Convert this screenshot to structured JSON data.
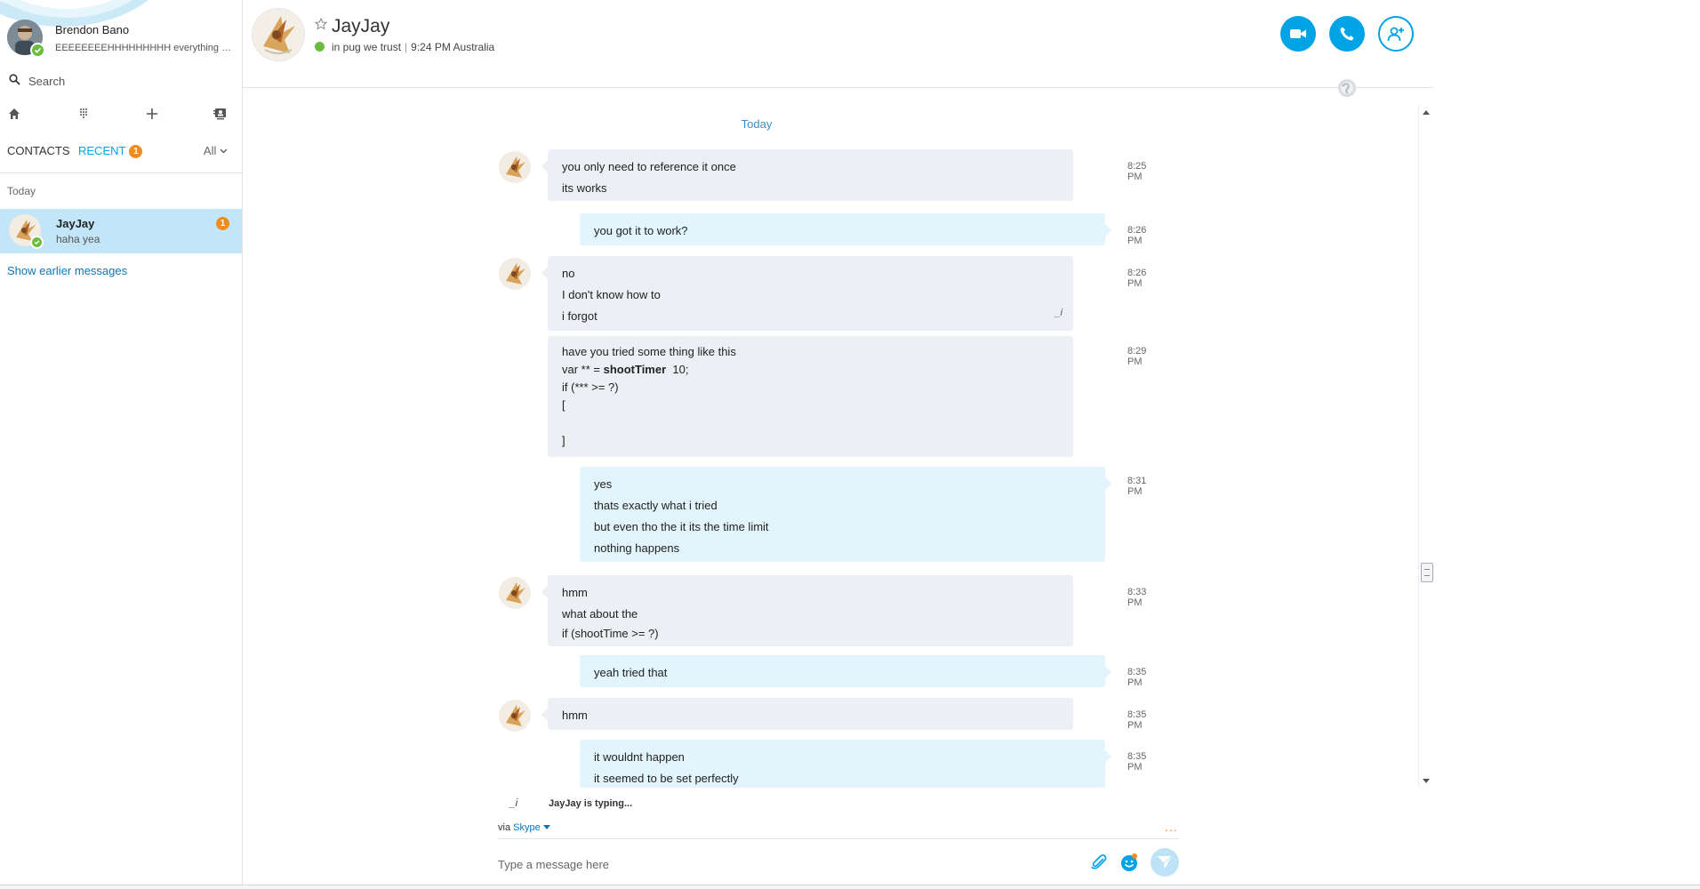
{
  "colors": {
    "accent": "#00a3e6",
    "link": "#0a77b8",
    "badge": "#f08b1d",
    "presence_online": "#6cbc3f",
    "incoming_bubble": "#eceff3",
    "outgoing_bubble": "#e2f4fc",
    "selected_row": "#c2e6f7"
  },
  "profile": {
    "name": "Brendon Bano",
    "mood": "EEEEEEEEHHHHHHHHH everything s...",
    "status": "online"
  },
  "search": {
    "placeholder": "Search"
  },
  "nav_icons": [
    "home-icon",
    "dialpad-icon",
    "plus-icon",
    "contacts-book-icon"
  ],
  "tabs": {
    "contacts": "CONTACTS",
    "recent": "RECENT",
    "recent_badge": "1",
    "filter": "All"
  },
  "recent_list": {
    "section_label": "Today",
    "items": [
      {
        "name": "JayJay",
        "preview": "haha yea",
        "badge": "1",
        "status": "online"
      }
    ],
    "show_earlier": "Show earlier messages"
  },
  "header": {
    "contact_name": "JayJay",
    "mood": "in pug we trust",
    "local_time": "9:24 PM Australia",
    "buttons": [
      "video-call",
      "audio-call",
      "add-people"
    ]
  },
  "conversation": {
    "date_divider": "Today",
    "messages": [
      {
        "dir": "in",
        "time": "8:25 PM",
        "lines": [
          "you only need to reference it once",
          "its works"
        ]
      },
      {
        "dir": "out",
        "time": "8:26 PM",
        "lines": [
          "you got it to work?"
        ]
      },
      {
        "dir": "in",
        "time": "8:26 PM",
        "lines": [
          "no",
          "I don't know how to",
          "i forgot"
        ],
        "edited_icon": "_i"
      },
      {
        "dir": "in",
        "time": "8:29 PM",
        "continued": true,
        "code": true,
        "lines": [
          "have you tried some thing like this",
          "var ** = ",
          "if (*** >= ?)",
          "[",
          "",
          "]"
        ],
        "bold_fragment": "shootTimer",
        "after_bold": "  10;"
      },
      {
        "dir": "out",
        "time": "8:31 PM",
        "lines": [
          "yes",
          "thats exactly what i tried",
          "but even tho the it its the time limit",
          "nothing happens"
        ]
      },
      {
        "dir": "in",
        "time": "8:33 PM",
        "lines": [
          "hmm",
          "what about the",
          "if (shootTime >= ?)"
        ]
      },
      {
        "dir": "out",
        "time": "8:35 PM",
        "lines": [
          "yeah tried that"
        ]
      },
      {
        "dir": "in",
        "time": "8:35 PM",
        "lines": [
          "hmm"
        ]
      },
      {
        "dir": "out",
        "time": "8:35 PM",
        "lines": [
          "it wouldnt happen",
          "it seemed to be set perfectly"
        ]
      }
    ]
  },
  "compose": {
    "typing_icon": "_i",
    "typing": "JayJay is typing...",
    "via_label": "via",
    "via_service": "Skype",
    "more": "...",
    "placeholder": "Type a message here"
  }
}
